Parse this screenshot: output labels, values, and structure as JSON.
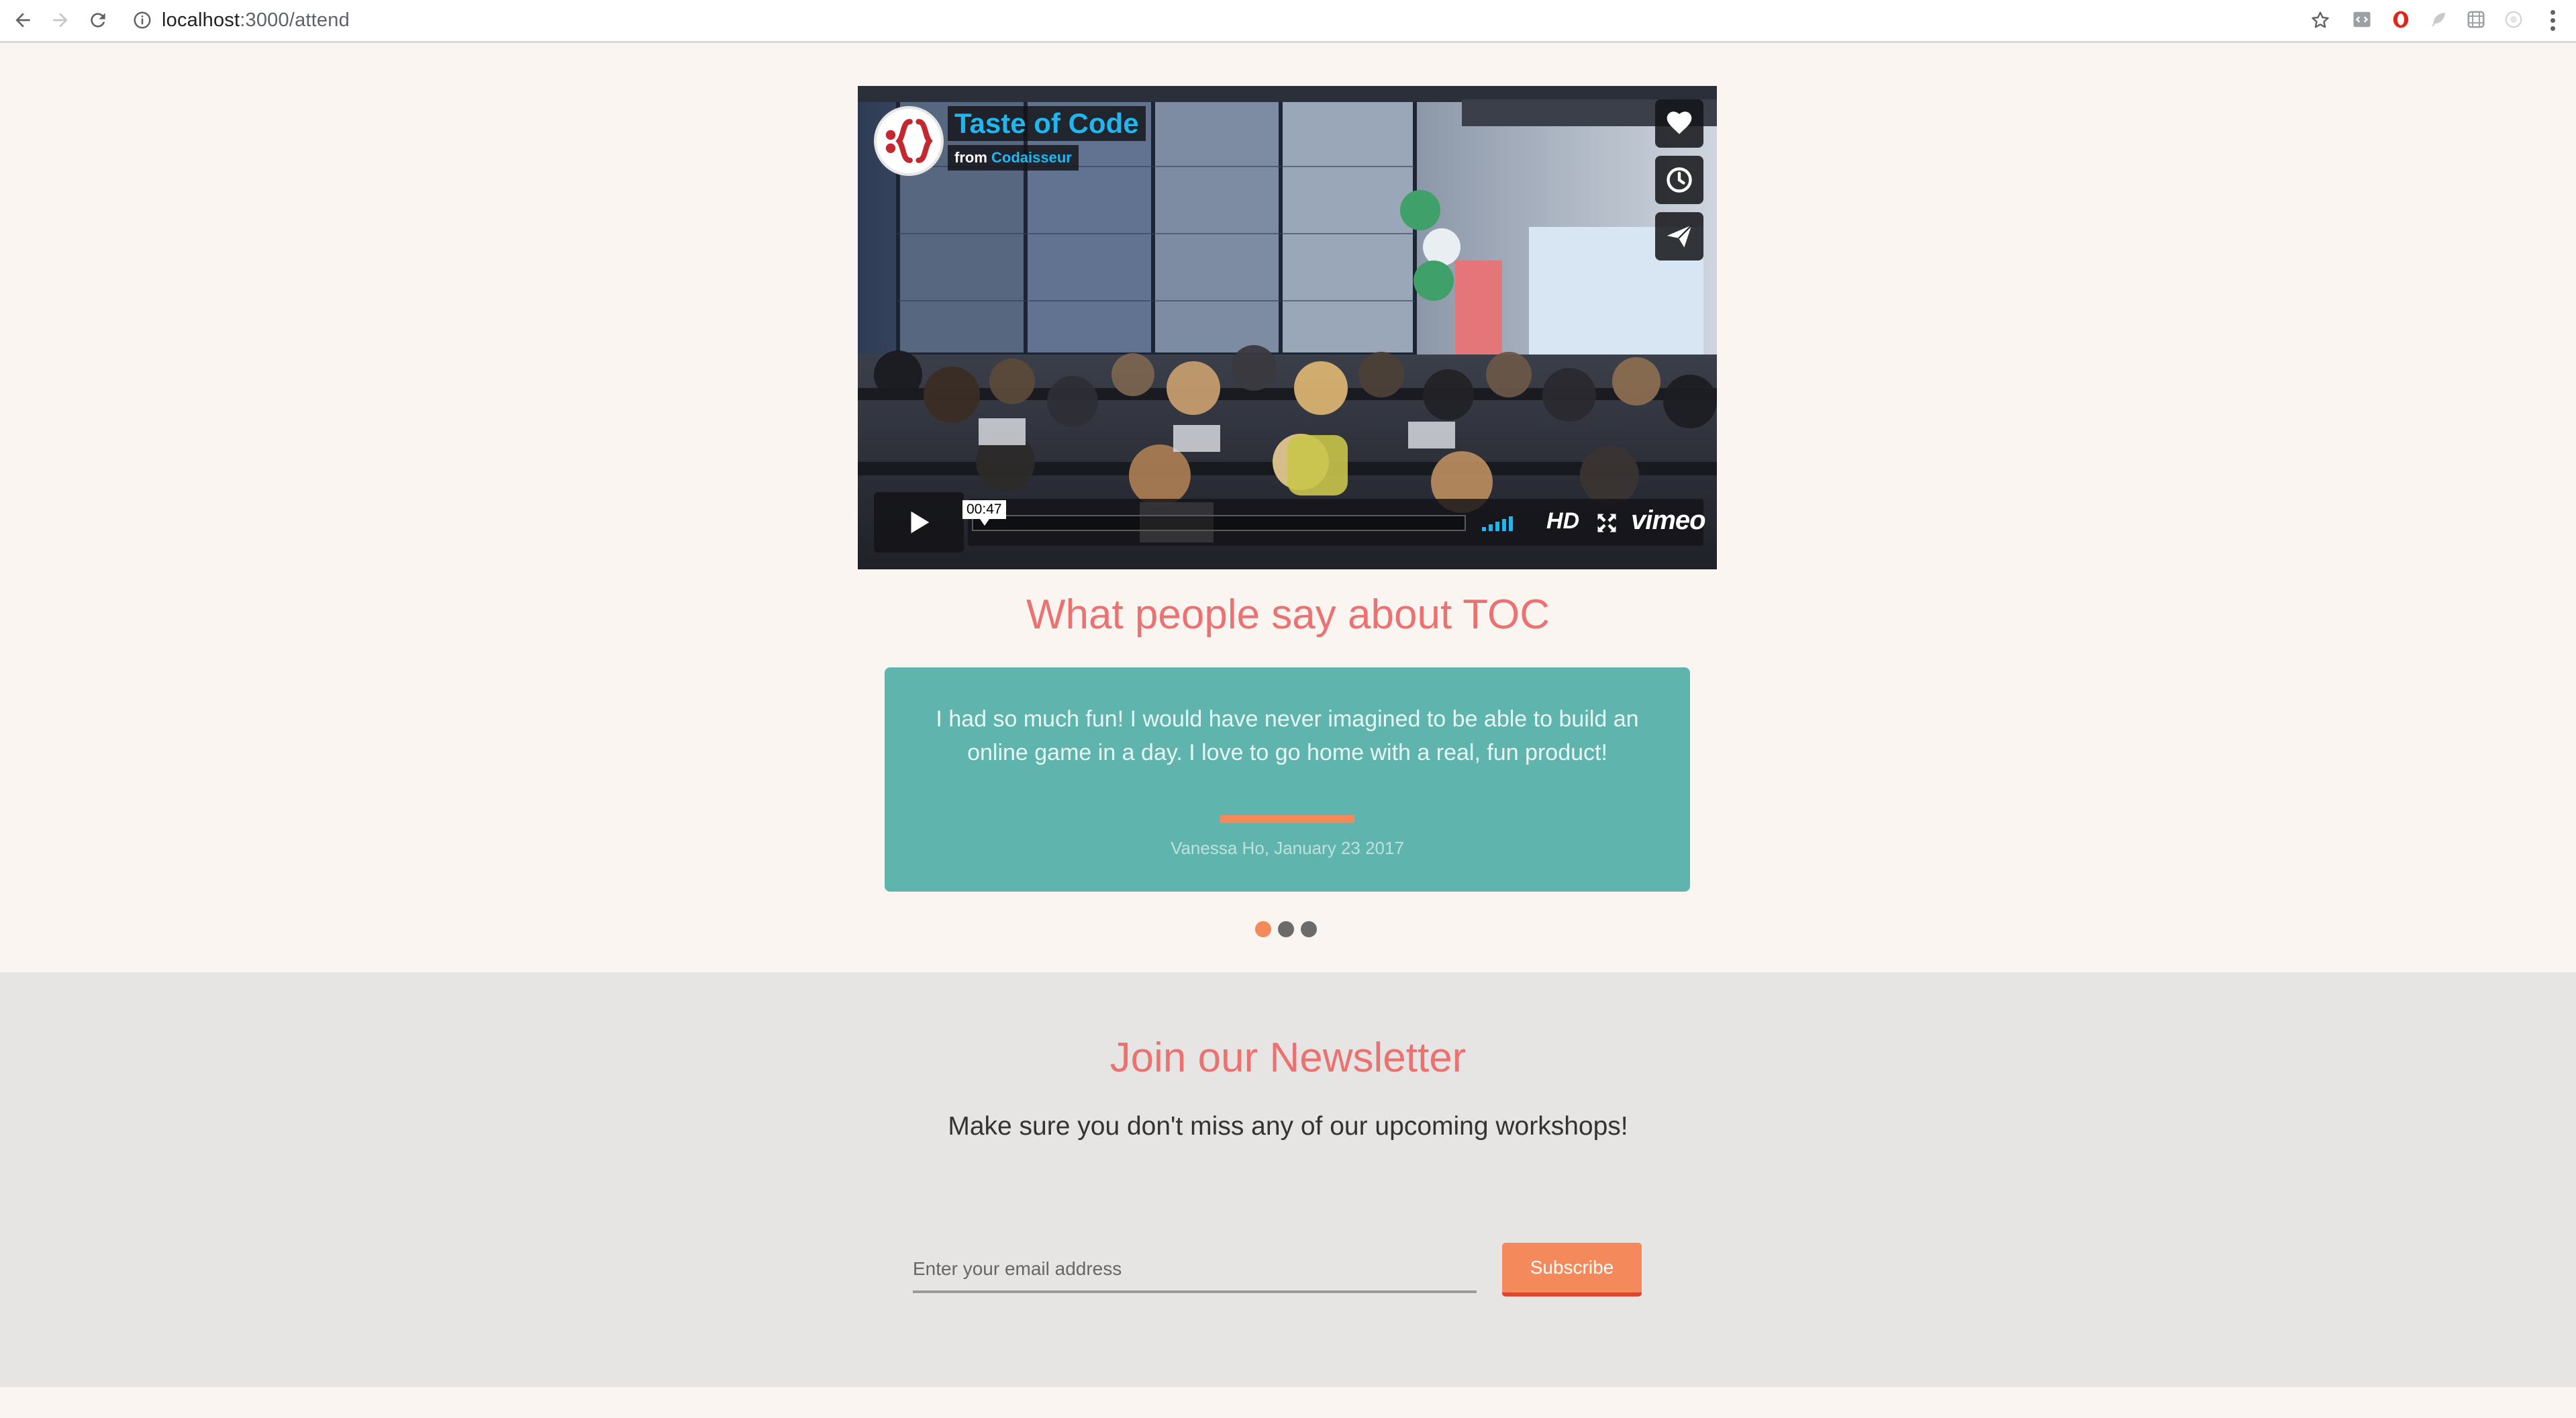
{
  "browser": {
    "url_host": "localhost",
    "url_path": ":3000/attend",
    "icons": [
      "back-arrow-icon",
      "forward-arrow-icon",
      "reload-icon",
      "info-icon",
      "star-icon",
      "extension-icons",
      "menu-dots-icon"
    ]
  },
  "video": {
    "title": "Taste of Code",
    "from_label": "from",
    "author": "Codaisseur",
    "timecode": "00:47",
    "hd_label": "HD",
    "provider": "vimeo",
    "side_buttons": [
      "heart-icon",
      "clock-icon",
      "send-icon"
    ],
    "accent_color": "#1fb7f0"
  },
  "testimonials": {
    "title": "What people say about TOC",
    "quote": "I had so much fun! I would have never imagined to be able to build an online game in a day. I love to go home with a real, fun product!",
    "author": "Vanessa Ho, January 23 2017",
    "slide_count": 3,
    "active_slide": 1,
    "card_color": "#5fb5ae",
    "accent_color": "#f48a5c"
  },
  "newsletter": {
    "title": "Join our Newsletter",
    "subtitle": "Make sure you don't miss any of our upcoming workshops!",
    "email_placeholder": "Enter your email address",
    "email_value": "",
    "subscribe_label": "Subscribe",
    "title_color": "#ec7272",
    "button_color": "#f48a5c"
  }
}
